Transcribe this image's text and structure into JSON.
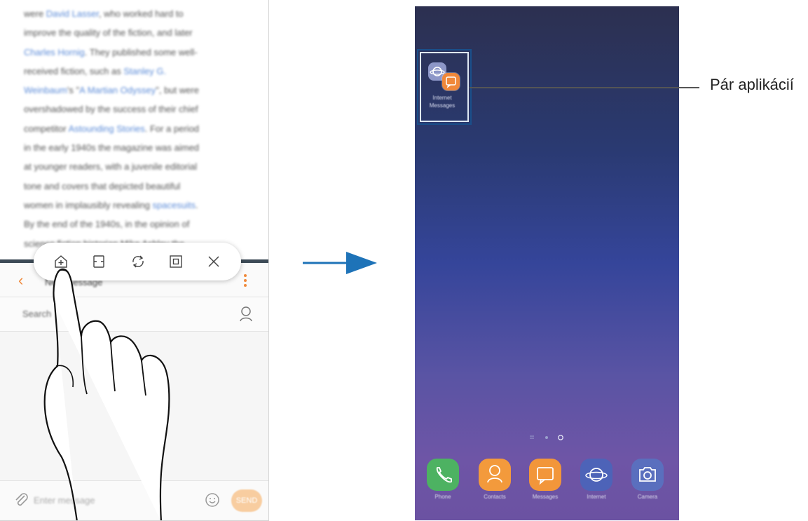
{
  "article": {
    "lines": [
      [
        {
          "t": "were "
        },
        {
          "t": "David Lasser",
          "link": true
        },
        {
          "t": ", who worked hard to"
        }
      ],
      [
        {
          "t": "improve the quality of the fiction, and later"
        }
      ],
      [
        {
          "t": "Charles Hornig",
          "link": true
        },
        {
          "t": ". They published some well-"
        }
      ],
      [
        {
          "t": "received fiction, such as "
        },
        {
          "t": "Stanley G.",
          "link": true
        }
      ],
      [
        {
          "t": "Weinbaum",
          "link": true
        },
        {
          "t": "'s \""
        },
        {
          "t": "A Martian Odyssey",
          "link": true
        },
        {
          "t": "\", but were"
        }
      ],
      [
        {
          "t": "overshadowed by the success of their chief"
        }
      ],
      [
        {
          "t": "competitor "
        },
        {
          "t": "Astounding Stories",
          "link": true
        },
        {
          "t": ". For a period"
        }
      ],
      [
        {
          "t": "in the early 1940s the magazine was aimed"
        }
      ],
      [
        {
          "t": "at younger readers, with a juvenile editorial"
        }
      ],
      [
        {
          "t": "tone and covers that depicted beautiful"
        }
      ],
      [
        {
          "t": "women in implausibly revealing "
        },
        {
          "t": "spacesuits",
          "link": true
        },
        {
          "t": "."
        }
      ],
      [
        {
          "t": "By the end of the 1940s, in the opinion of"
        }
      ],
      [
        {
          "t": "science fiction historian Mike Ashley the"
        }
      ]
    ]
  },
  "messages": {
    "title": "New message",
    "recipient": "Search",
    "compose_placeholder": "Enter message",
    "send_label": "SEND"
  },
  "toolbar": {
    "icons": [
      "add-app-pair-icon",
      "split-screen-view-icon",
      "switch-windows-icon",
      "pop-up-view-icon",
      "close-icon"
    ]
  },
  "homescreen": {
    "pair_label_line1": "Internet",
    "pair_label_line2": "Messages",
    "dock": [
      {
        "label": "Phone",
        "color": "#4db262",
        "icon": "phone-icon"
      },
      {
        "label": "Contacts",
        "color": "#f39a3c",
        "icon": "contacts-icon"
      },
      {
        "label": "Messages",
        "color": "#f2963a",
        "icon": "messages-icon"
      },
      {
        "label": "Internet",
        "color": "#4d63b8",
        "icon": "internet-icon"
      },
      {
        "label": "Camera",
        "color": "#5a6fbe",
        "icon": "camera-icon"
      }
    ]
  },
  "callout": {
    "text": "Pár aplikácií"
  },
  "colors": {
    "accent_orange": "#f08a3c",
    "link_blue": "#5b8bd8",
    "callout_box": "#1a4f8a"
  }
}
